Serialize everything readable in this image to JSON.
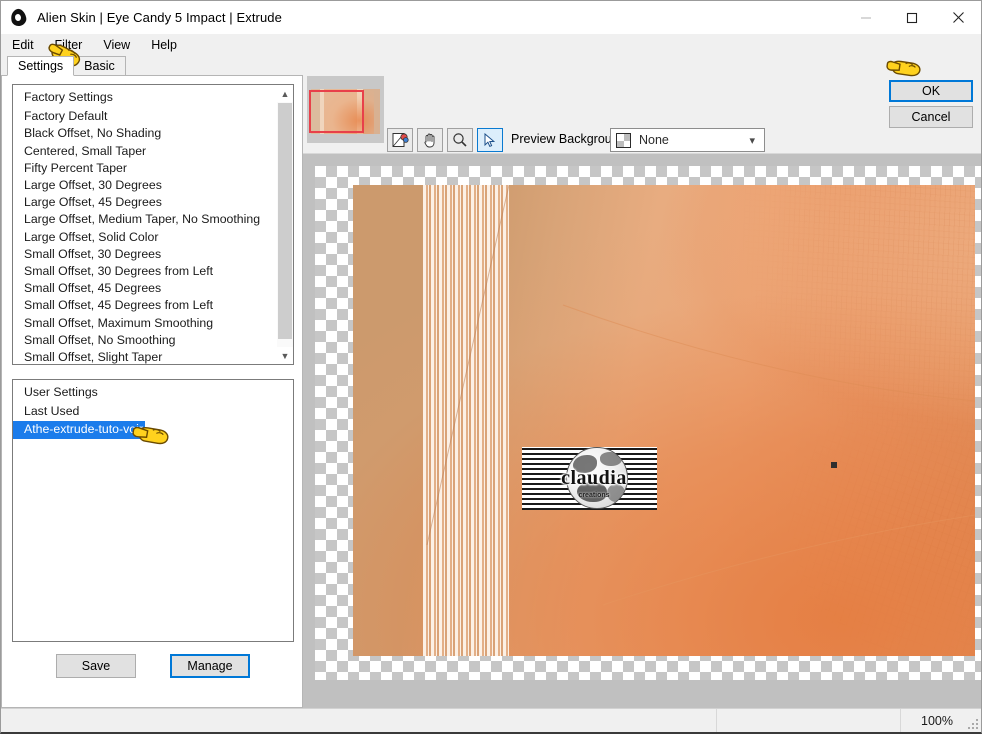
{
  "window": {
    "title": "Alien Skin | Eye Candy 5 Impact | Extrude",
    "app_icon": "alien-skin-icon",
    "controls": {
      "minimize": "minimize-icon",
      "maximize": "maximize-icon",
      "close": "close-icon"
    }
  },
  "menubar": {
    "items": [
      "Edit",
      "Filter",
      "View",
      "Help"
    ]
  },
  "tabs": [
    {
      "label": "Settings",
      "active": true
    },
    {
      "label": "Basic",
      "active": false
    }
  ],
  "factory_list": {
    "header": "Factory Settings",
    "items": [
      "Factory Default",
      "Black Offset, No Shading",
      "Centered, Small Taper",
      "Fifty Percent Taper",
      "Large Offset, 30 Degrees",
      "Large Offset, 45 Degrees",
      "Large Offset, Medium Taper, No Smoothing",
      "Large Offset, Solid Color",
      "Small Offset, 30 Degrees",
      "Small Offset, 30 Degrees from Left",
      "Small Offset, 45 Degrees",
      "Small Offset, 45 Degrees from Left",
      "Small Offset, Maximum Smoothing",
      "Small Offset, No Smoothing",
      "Small Offset, Slight Taper"
    ]
  },
  "user_list": {
    "header": "User Settings",
    "items": [
      {
        "label": "Last Used",
        "selected": false
      },
      {
        "label": "Athe-extrude-tuto-voir",
        "selected": true
      }
    ]
  },
  "left_buttons": {
    "save": "Save",
    "manage": "Manage"
  },
  "toolbar": {
    "navigator": "navigator-thumbnail",
    "tools": [
      {
        "name": "image-preview-tool",
        "active": false
      },
      {
        "name": "hand-pan-tool",
        "active": false
      },
      {
        "name": "zoom-magnifier-tool",
        "active": false
      },
      {
        "name": "arrow-select-tool",
        "active": true
      }
    ],
    "preview_background": {
      "label": "Preview Background:",
      "value": "None",
      "swatch": "checkerboard-swatch",
      "chevron": "chevron-down-icon"
    }
  },
  "dialog_buttons": {
    "ok": "OK",
    "cancel": "Cancel"
  },
  "preview": {
    "watermark_text": "claudia",
    "watermark_subtext": "creations",
    "alt": "extruded-orange-texture-preview"
  },
  "statusbar": {
    "zoom": "100%"
  },
  "colors": {
    "accent_blue": "#0078d7",
    "selection_blue": "#1b7ceb",
    "nav_rect_red": "#e8404a",
    "window_bg": "#f0f0f0",
    "panel_bg": "#ffffff",
    "canvas_gray": "#c0c0c0",
    "art_tan": "#cc9a6d",
    "art_orange": "#e57e42",
    "art_extrude_brown": "#7c4b3f",
    "cursor_yellow": "#ffd21e"
  }
}
